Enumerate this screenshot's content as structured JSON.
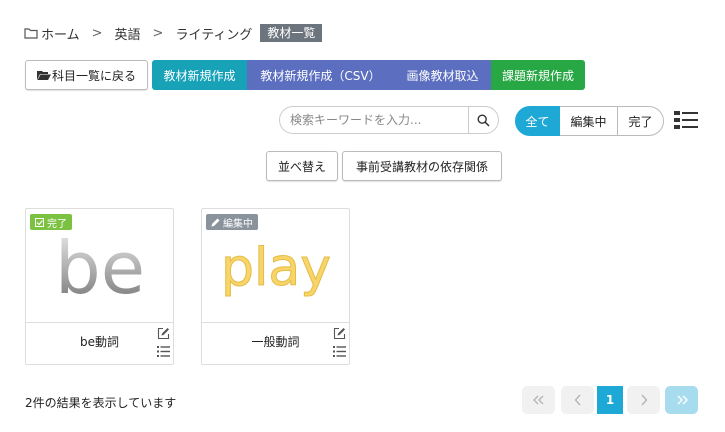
{
  "breadcrumb": {
    "home": "ホーム",
    "subject": "英語",
    "unit": "ライティング",
    "current": "教材一覧"
  },
  "actions": {
    "back": "科目一覧に戻る",
    "new_material": "教材新規作成",
    "new_material_csv": "教材新規作成（CSV）",
    "image_import": "画像教材取込",
    "new_task": "課題新規作成"
  },
  "search": {
    "placeholder": "検索キーワードを入力..."
  },
  "filter": {
    "all": "全て",
    "editing": "編集中",
    "done": "完了",
    "selected": "全て"
  },
  "sort": {
    "sort_label": "並べ替え",
    "dependency_label": "事前受講教材の依存関係"
  },
  "cards": [
    {
      "status": "完了",
      "thumb_text": "be",
      "title": "be動詞"
    },
    {
      "status": "編集中",
      "thumb_text": "play",
      "title": "一般動詞"
    }
  ],
  "result": {
    "summary": "2件の結果を表示しています"
  },
  "pagination": {
    "first": "«",
    "prev": "‹",
    "current": "1",
    "next": "›",
    "last": "»"
  },
  "colors": {
    "teal": "#17a2b8",
    "indigo": "#5b6ec0",
    "green": "#28a745",
    "accent_blue": "#1ea8d6",
    "badge_done": "#7cc242",
    "badge_editing": "#8a939b"
  }
}
